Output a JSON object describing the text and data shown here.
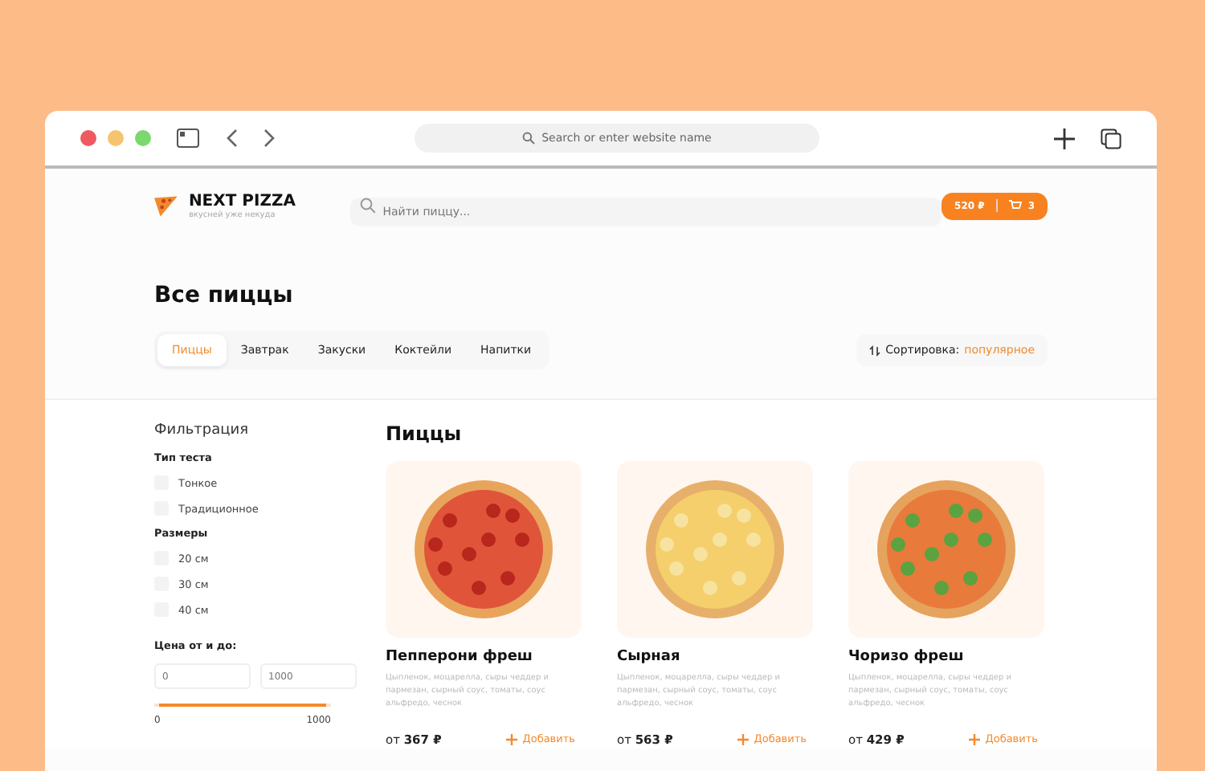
{
  "browser": {
    "address_placeholder": "Search or enter website name"
  },
  "header": {
    "logo": "NEXT PIZZA",
    "tagline": "вкусней уже некуда",
    "search_placeholder": "Найти пиццу...",
    "cart_total": "520 ₽",
    "cart_count": "3"
  },
  "title": "Все пиццы",
  "categories": [
    {
      "label": "Пиццы",
      "selected": true
    },
    {
      "label": "Завтрак",
      "selected": false
    },
    {
      "label": "Закуски",
      "selected": false
    },
    {
      "label": "Коктейли",
      "selected": false
    },
    {
      "label": "Напитки",
      "selected": false
    }
  ],
  "sort": {
    "label": "Сортировка:",
    "value": "популярное"
  },
  "filters": {
    "title": "Фильтрация",
    "groups": [
      {
        "title": "Тип теста",
        "options": [
          {
            "label": "Тонкое",
            "checked": false
          },
          {
            "label": "Традиционное",
            "checked": false
          }
        ]
      },
      {
        "title": "Размеры",
        "options": [
          {
            "label": "20 см",
            "checked": false
          },
          {
            "label": "30 см",
            "checked": false
          },
          {
            "label": "40 см",
            "checked": false
          }
        ]
      }
    ],
    "price": {
      "title": "Цена от и до:",
      "from_placeholder": "0",
      "to_placeholder": "1000",
      "level": 1,
      "min_label": "0",
      "max_label": "1000"
    }
  },
  "section_title": "Пиццы",
  "products": [
    {
      "name": "Пепперони фреш",
      "kind": "pepperoni",
      "description": "Цыпленок, моцарелла, сыры чеддер и пармезан, сырный соус, томаты, соус альфредо, чеснок",
      "price_prefix": "от",
      "price": "367 ₽",
      "add": "Добавить"
    },
    {
      "name": "Сырная",
      "kind": "cheese",
      "description": "Цыпленок, моцарелла, сыры чеддер и пармезан, сырный соус, томаты, соус альфредо, чеснок",
      "price_prefix": "от",
      "price": "563 ₽",
      "add": "Добавить"
    },
    {
      "name": "Чоризо фреш",
      "kind": "chorizo",
      "description": "Цыпленок, моцарелла, сыры чеддер и пармезан, сырный соус, томаты, соус альфредо, чеснок",
      "price_prefix": "от",
      "price": "429 ₽",
      "add": "Добавить"
    }
  ]
}
